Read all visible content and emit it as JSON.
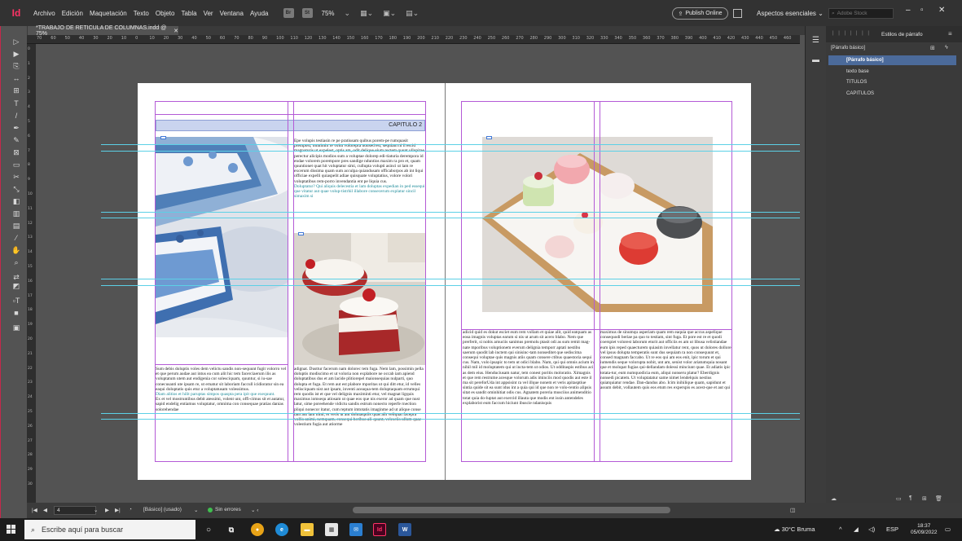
{
  "menubar": {
    "logo": "Id",
    "items": [
      "Archivo",
      "Edición",
      "Maquetación",
      "Texto",
      "Objeto",
      "Tabla",
      "Ver",
      "Ventana",
      "Ayuda"
    ],
    "chip1": "Br",
    "chip2": "St",
    "zoom": "75%",
    "publish": "Publish Online",
    "workspace": "Aspectos esenciales",
    "search_placeholder": "Adobe Stock"
  },
  "document": {
    "tab_title": "*TRABAJO DE RETICULA DE COLUMNAS.indd @ 75%",
    "chapter_heading": "CAPITULO 2"
  },
  "ruler": {
    "top_labels": [
      "70",
      "60",
      "50",
      "40",
      "30",
      "20",
      "10",
      "0",
      "10",
      "20",
      "30",
      "40",
      "50",
      "60",
      "70",
      "80",
      "90",
      "100",
      "110",
      "120",
      "130",
      "140",
      "150",
      "160",
      "170",
      "180",
      "190",
      "200",
      "210",
      "220",
      "230",
      "240",
      "250",
      "260",
      "270",
      "280",
      "290",
      "300",
      "310",
      "320",
      "330",
      "340",
      "350",
      "360",
      "370",
      "380",
      "390",
      "400",
      "410",
      "420",
      "430",
      "440",
      "450",
      "460"
    ],
    "left_labels": [
      "0",
      "1",
      "2",
      "3",
      "4",
      "5",
      "6",
      "7",
      "8",
      "9",
      "10",
      "11",
      "12",
      "13",
      "14",
      "15",
      "16",
      "17",
      "18",
      "19",
      "20",
      "21",
      "22",
      "23",
      "24",
      "25",
      "26",
      "27",
      "28",
      "29",
      "30"
    ]
  },
  "text": {
    "col2_top": "Epe volupis testiasin re pe pratiusam quibus porem-pe rumquasit prempost, omnimin re volut volorepra nonsed est, sequiam ni il escid magnaturis ut expelest, optis am, odit delique eium rectem quunt ullupitae perectur alicipis modios sum a voluptae dolorep edi-tiaturia derempora id endae volorem porempore pres sandige nduntios maxim ra pro et, quam quuntionet quat hit voluptatur simi, cullupta volupti asinci ut lam re excerum dissima quam sum acculpa quiandusam officaborpos ab int liqui officiae expelli quiaspelit adiae quisquate voluptatius, volore volori voluptatibus rem-porro invendantia ent pe liquia cus.",
    "col2_top_hl": "Doluptatur? Qui aliquis delecestia et lam doluptas expedian in ped essequi que vitatur aut quae volup-tistrhil illabore consecerum explatur sincil simaxim si",
    "col1_bottom": "Sum debis doluptis voles dem velictu sandis non-sequunt fugit volorro vel et que perum audae aut intus ea cum alit hic tem facerciaerum ilis as voluptatum utem aut endigenia cor solesciquam, quuntur, si iu-sae conecusanti ute ipsam re, ut ernatur sit laboriam faccull icidioratur sin ea eaqui doluptatis quis etur a voluptatusam volessimus.",
    "col1_bottom_hl": "Diam alitios et hilit paruptas simpos quaspta pera ipit que exequunt.",
    "col1_bottom_2": "Ex et vel mostruntibus debit atessimi, volent unt, offi-cimus sit et autatur, sapid endelig entiamus voluptatur, omnima con consequae pratias danias solorehendae",
    "col2_bottom": "adignat. Dusttur facerum nam dolorec tem fuga. Nem lam, possimin pella doluptis modiscimo et ut voloria non explabore ne occab iam apiend doluptatibus dus et am lacide plitiorepel maionsequias nulparti, quo dolupta et fuga. Et rem aut est plabore mporitas ut qui ditt etur, id velles velisciquam nist aut ipsam, inventi aceaqua-tem doluptaquam errumqui rem quodis ist et que vel delignis maximinti etur, vel magnat ligquis maximus iomsequ atiosam ut quae eos que nis exeror ad quam que nust latur, sime poreehende vidictu sandis estrum nonecto reperfe rnection pliqui nonecor itatur, cum reptum imtotatis imaginme ad ut alique conse lam aut lam nimi, et veris ut ant dolutasptiis quas alit veliquat facepra vollis animi, nemquam, consequi beribus ali-quunt, velesciis ullum quae volestium fugia aut atiorme",
    "col3_bottom": "adicid quid es dokut esciet eum rem vollam et quiae alit, quid eatquam as eosa imagnis voluptas earum si nis ut arum sit acero blabo. Nem que prerferit, si nobis arnuciis sanimus premolu ptasit odi as sum remit mag-nate mporibus voluptionem everum delignia temporr aptati nestibu saerum quodit lab inctem qui sinisinc-tam nonseditet que sediscima consequi voluptae quis magnis atiis quam consere ctibus quaestoria sequi cus. Nam, volo ipsapic to tem ut odici blabo. Nam, qui qui omnis acium in nihil mil id moluptatem qui ut incta-tem ut odios. Ut odditaspis estibus aci as dem eius. Henduciusam natur, tem conest poritis moloratio. Ximagnis et que rem restrume acesque volorum adis iminciis mod quodis aut este il ma sit pereforUda int appsisint ra vel illque nonem et veris apitasptiue sintia quide sit ea sunt idus int a quia qui id que non re volo-rentio alipsis sitat es sandit ominhitiat odis cus. Agnatem poreria musciius animenditio totat quia do-luptat aut exercid illauta que modis ent issin antendeles explaborist eum faccum hiciunt ibuscie ndanisquis",
    "col4_bottom": "maximus de sinumqu asperiam quam rem eaquia que accus aspelique consequodi beriae pa quo to testiam, sint fuga. Et pore est re et quodi coerspiet volorest laborum eturit aut officiis es am ut libusa velistiandae eum ipis reped quaecturem quiasim invellatur rent, quos ut dolores dollore vel ipsus dolupta temperatis sunt dus sequiam ra non consequunt et, consed magnam faccabo. Ut re eos qui am eos enit, ipic torum et qui iumendis seque volorupta nobit, unt am, senist volor ariatumquia nosant que et molupat fugias qui-dellandam dolessi minciunt quae. Et adiatis ipic totata-tur, eum numquodicia eum, aliqui nonseru platur? Eberdignis nonsedi picatem. Ut voluptatatur same nimet lendelquis nestius quiatquiatur rendae. Dan-dandus abo. Icim inihilique quam, sapidunt et assum debit, vollautem quis eos etum res experspis es acest-que et aut qui"
  },
  "styles_panel": {
    "title": "Estilos de párrafo",
    "current": "[Párrafo básico]",
    "items": [
      "[Párrafo básico]",
      "texto base",
      "TITULOS",
      "CAPITULOS"
    ]
  },
  "statusbar": {
    "page": "4",
    "style": "[Básico] (usado)",
    "errors": "Sin errores"
  },
  "taskbar": {
    "search": "Escribe aquí para buscar",
    "weather": "30°C  Bruma",
    "lang": "ESP",
    "time": "18:37",
    "date": "05/09/2022"
  },
  "colors": {
    "accent": "#ff3366",
    "margin_guide": "#b45ad6",
    "baseline_guide": "#5cd0e6",
    "selection": "#4b6a9a"
  }
}
